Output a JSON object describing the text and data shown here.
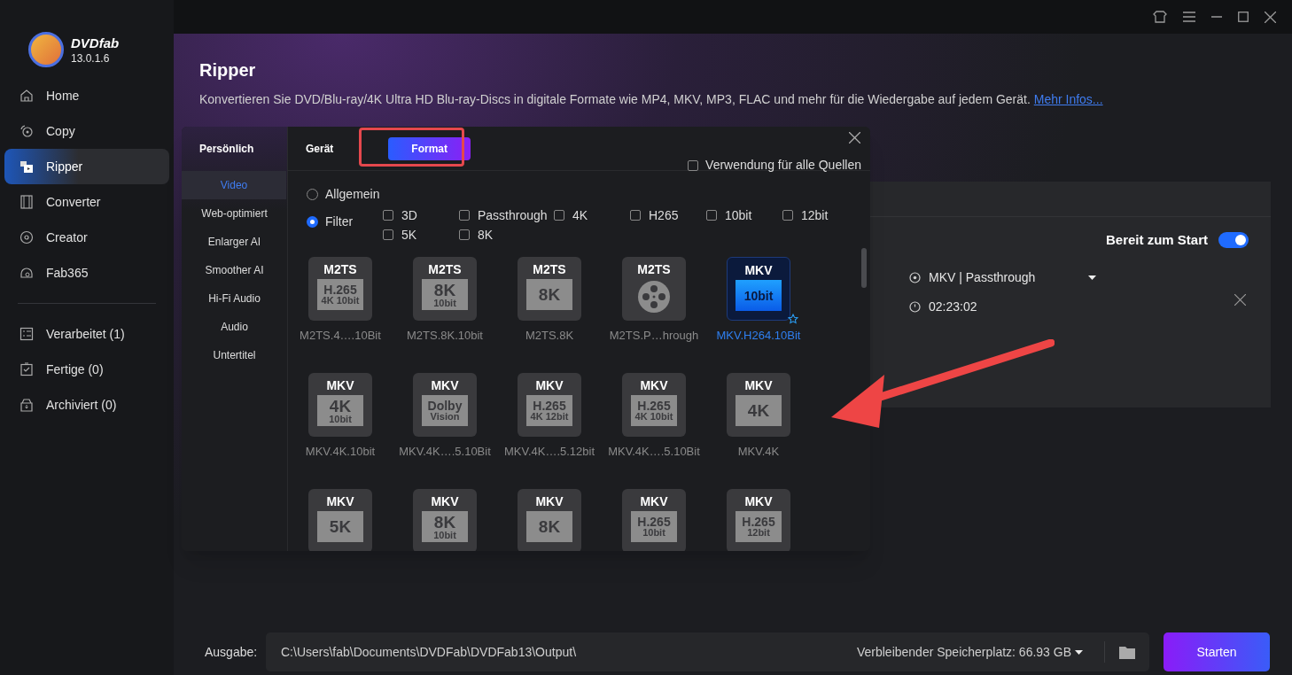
{
  "app": {
    "name": "DVDfab",
    "version": "13.0.1.6"
  },
  "sidebar": {
    "items": [
      {
        "label": "Home",
        "kind": "home",
        "selected": false
      },
      {
        "label": "Copy",
        "kind": "copy",
        "selected": false
      },
      {
        "label": "Ripper",
        "kind": "ripper",
        "selected": true
      },
      {
        "label": "Converter",
        "kind": "film",
        "selected": false
      },
      {
        "label": "Creator",
        "kind": "disc",
        "selected": false
      },
      {
        "label": "Fab365",
        "kind": "fab",
        "selected": false
      }
    ],
    "queue": [
      {
        "label": "Verarbeitet (1)",
        "kind": "list"
      },
      {
        "label": "Fertige (0)",
        "kind": "done"
      },
      {
        "label": "Archiviert (0)",
        "kind": "archive"
      }
    ]
  },
  "page": {
    "title": "Ripper",
    "description": "Konvertieren Sie DVD/Blu-ray/4K Ultra HD Blu-ray-Discs in digitale Formate wie MP4, MKV, MP3, FLAC und mehr für die Wiedergabe auf jedem Gerät.",
    "link": "Mehr Infos..."
  },
  "task": {
    "ready_label": "Bereit zum Start",
    "ready": true,
    "profile": "MKV | Passthrough",
    "duration": "02:23:02"
  },
  "dialog": {
    "section": "Persönlich",
    "tabs": [
      {
        "label": "Gerät",
        "selected": false
      },
      {
        "label": "Format",
        "selected": true
      }
    ],
    "apply_all": {
      "label": "Verwendung für alle Quellen",
      "checked": false
    },
    "categories": [
      {
        "label": "Video",
        "selected": true
      },
      {
        "label": "Web-optimiert",
        "selected": false
      },
      {
        "label": "Enlarger AI",
        "selected": false
      },
      {
        "label": "Smoother AI",
        "selected": false
      },
      {
        "label": "Hi-Fi Audio",
        "selected": false
      },
      {
        "label": "Audio",
        "selected": false
      },
      {
        "label": "Untertitel",
        "selected": false
      }
    ],
    "modes": [
      {
        "label": "Allgemein",
        "selected": false
      },
      {
        "label": "Filter",
        "selected": true
      }
    ],
    "filters": [
      {
        "label": "3D",
        "checked": false
      },
      {
        "label": "Passthrough",
        "checked": false
      },
      {
        "label": "4K",
        "checked": false
      },
      {
        "label": "H265",
        "checked": false
      },
      {
        "label": "10bit",
        "checked": false
      },
      {
        "label": "12bit",
        "checked": false
      },
      {
        "label": "5K",
        "checked": false
      },
      {
        "label": "8K",
        "checked": false
      }
    ],
    "formats": [
      {
        "kind": "badge",
        "container": "M2TS",
        "badge": [
          "H.265",
          "4K 10bit"
        ],
        "label": "M2TS.4….10Bit",
        "selected": false
      },
      {
        "kind": "badge",
        "container": "M2TS",
        "badge": [
          "8K",
          "10bit"
        ],
        "label": "M2TS.8K.10bit",
        "selected": false
      },
      {
        "kind": "badge",
        "container": "M2TS",
        "badge": [
          "8K"
        ],
        "label": "M2TS.8K",
        "selected": false
      },
      {
        "kind": "reel",
        "container": "M2TS",
        "label": "M2TS.P…hrough",
        "selected": false
      },
      {
        "kind": "badge",
        "container": "MKV",
        "badge": [
          "10bit"
        ],
        "label": "MKV.H264.10Bit",
        "selected": true
      },
      {
        "kind": "badge",
        "container": "MKV",
        "badge": [
          "4K",
          "10bit"
        ],
        "label": "MKV.4K.10bit",
        "selected": false
      },
      {
        "kind": "badge",
        "container": "MKV",
        "badge": [
          "Dolby",
          "Vision"
        ],
        "label": "MKV.4K….5.10Bit",
        "selected": false
      },
      {
        "kind": "badge",
        "container": "MKV",
        "badge": [
          "H.265",
          "4K 12bit"
        ],
        "label": "MKV.4K….5.12bit",
        "selected": false
      },
      {
        "kind": "badge",
        "container": "MKV",
        "badge": [
          "H.265",
          "4K 10bit"
        ],
        "label": "MKV.4K….5.10Bit",
        "selected": false
      },
      {
        "kind": "badge",
        "container": "MKV",
        "badge": [
          "4K"
        ],
        "label": "MKV.4K",
        "selected": false
      },
      {
        "kind": "badge",
        "container": "MKV",
        "badge": [
          "5K"
        ],
        "selected": false
      },
      {
        "kind": "badge",
        "container": "MKV",
        "badge": [
          "8K",
          "10bit"
        ],
        "selected": false
      },
      {
        "kind": "badge",
        "container": "MKV",
        "badge": [
          "8K"
        ],
        "selected": false
      },
      {
        "kind": "badge",
        "container": "MKV",
        "badge": [
          "H.265",
          "10bit"
        ],
        "selected": false
      },
      {
        "kind": "badge",
        "container": "MKV",
        "badge": [
          "H.265",
          "12bit"
        ],
        "selected": false
      }
    ]
  },
  "output": {
    "label": "Ausgabe:",
    "path": "C:\\Users\\fab\\Documents\\DVDFab\\DVDFab13\\Output\\",
    "space": "Verbleibender Speicherplatz: 66.93 GB",
    "start": "Starten"
  }
}
